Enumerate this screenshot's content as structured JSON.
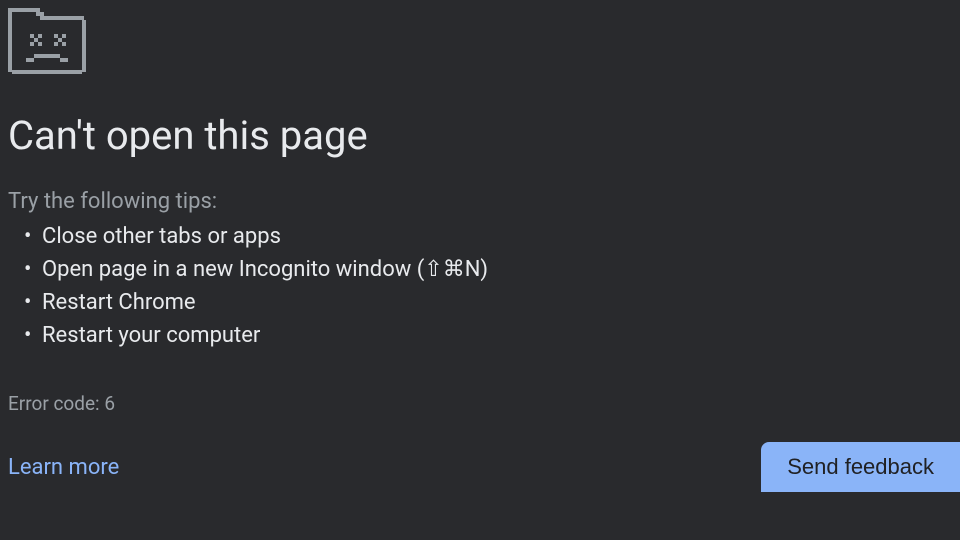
{
  "heading": "Can't open this page",
  "tips_intro": "Try the following tips:",
  "tips": [
    "Close other tabs or apps",
    "Open page in a new Incognito window (⇧⌘N)",
    "Restart Chrome",
    "Restart your computer"
  ],
  "error_code": "Error code: 6",
  "learn_more": "Learn more",
  "send_feedback": "Send feedback"
}
